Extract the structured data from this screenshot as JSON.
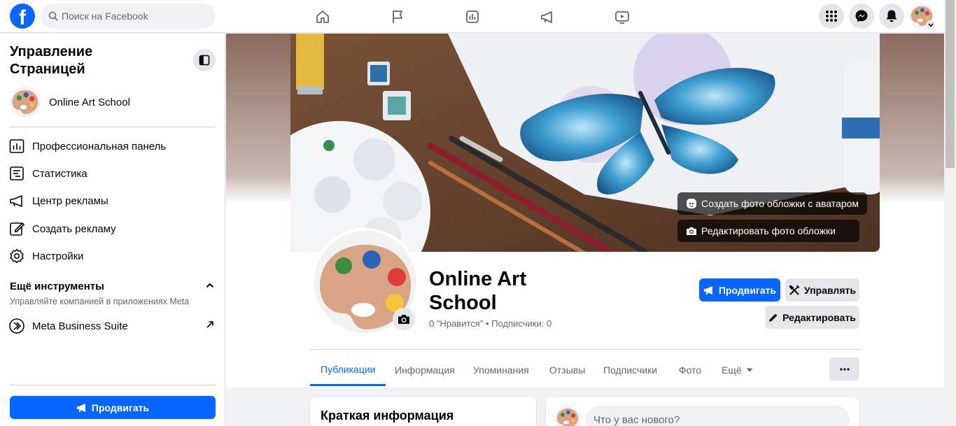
{
  "topbar": {
    "logo": "f",
    "search_placeholder": "Поиск на Facebook",
    "nav_icons": [
      "home-icon",
      "flag-icon",
      "insights-icon",
      "megaphone-icon",
      "video-icon"
    ],
    "right_icons": [
      "menu-grid-icon",
      "messenger-icon",
      "notifications-bell-icon"
    ]
  },
  "sidebar": {
    "title": "Управление Страницей",
    "page_name": "Online Art School",
    "items": [
      {
        "label": "Профессиональная панель",
        "icon": "dashboard-icon"
      },
      {
        "label": "Статистика",
        "icon": "stats-icon"
      },
      {
        "label": "Центр рекламы",
        "icon": "megaphone-icon"
      },
      {
        "label": "Создать рекламу",
        "icon": "edit-icon"
      },
      {
        "label": "Настройки",
        "icon": "gear-icon"
      }
    ],
    "more_tools_title": "Ещё инструменты",
    "more_tools_subtitle": "Управляйте компанией в приложениях Meta",
    "meta_suite_label": "Meta Business Suite",
    "promote_label": "Продвигать"
  },
  "cover": {
    "avatar_cover_label": "Создать фото обложки с аватаром",
    "edit_cover_label": "Редактировать фото обложки"
  },
  "profile": {
    "name": "Online Art School",
    "stats": "0 \"Нравится\" • Подписчики: 0",
    "promote_label": "Продвигать",
    "manage_label": "Управлять",
    "edit_label": "Редактировать"
  },
  "tabs": [
    {
      "label": "Публикации",
      "active": true
    },
    {
      "label": "Информация",
      "active": false
    },
    {
      "label": "Упоминания",
      "active": false
    },
    {
      "label": "Отзывы",
      "active": false
    },
    {
      "label": "Подписчики",
      "active": false
    },
    {
      "label": "Фото",
      "active": false
    },
    {
      "label": "Ещё",
      "active": false
    }
  ],
  "intro_card": {
    "title": "Краткая информация"
  },
  "composer": {
    "placeholder": "Что у вас нового?"
  },
  "colors": {
    "accent": "#0866ff",
    "gray_button": "#e4e6eb",
    "background": "#f0f2f5"
  }
}
